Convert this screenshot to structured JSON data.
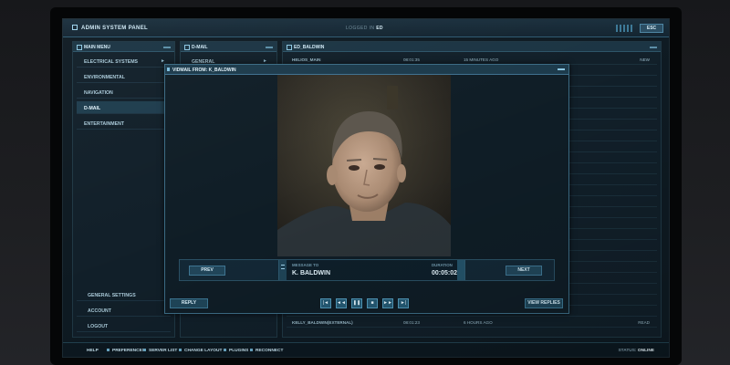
{
  "window": {
    "title": "ADMIN SYSTEM PANEL",
    "logged_prefix": "LOGGED IN",
    "logged_user": "ED",
    "esc_label": "ESC"
  },
  "main_menu": {
    "header": "MAIN MENU",
    "items": [
      {
        "label": "ELECTRICAL SYSTEMS",
        "arrow": "►"
      },
      {
        "label": "ENVIRONMENTAL",
        "arrow": ""
      },
      {
        "label": "NAVIGATION",
        "arrow": ""
      },
      {
        "label": "D-MAIL",
        "arrow": ""
      },
      {
        "label": "ENTERTAINMENT",
        "arrow": ""
      }
    ],
    "settings": [
      "GENERAL SETTINGS",
      "ACCOUNT",
      "LOGOUT"
    ]
  },
  "dmail": {
    "header": "D-MAIL",
    "items": [
      {
        "label": "GENERAL",
        "arrow": "►"
      }
    ]
  },
  "inbox": {
    "header": "ED_BALDWIN",
    "rows": [
      {
        "from": "HELIOS_MAIN",
        "time": "08:01:35",
        "ago": "15 MINUTES AGO",
        "status": "NEW"
      },
      {
        "from": "KELLY_BALDWIN(EXTERNAL)",
        "time": "08:01:23",
        "ago": "6 HOURS AGO",
        "status": "READ"
      }
    ]
  },
  "vidmail": {
    "title": "VIDMAIL FROM: K_BALDWIN",
    "prev_label": "PREV",
    "next_label": "NEXT",
    "message_to_label": "MESSAGE TO",
    "recipient": "K. BALDWIN",
    "duration_label": "DURATION",
    "duration": "00:05:02",
    "reply_label": "REPLY",
    "view_replies_label": "VIEW REPLIES",
    "controls": [
      "|◄",
      "◄◄",
      "❚❚",
      "■",
      "►►",
      "►|"
    ]
  },
  "taskbar": {
    "items": [
      "HELP",
      "PREFERENCES",
      "SERVER LIST",
      "CHANGE LAYOUT",
      "PLUGINS",
      "RECONNECT"
    ],
    "status_label": "STATUS:",
    "status_value": "ONLINE"
  }
}
